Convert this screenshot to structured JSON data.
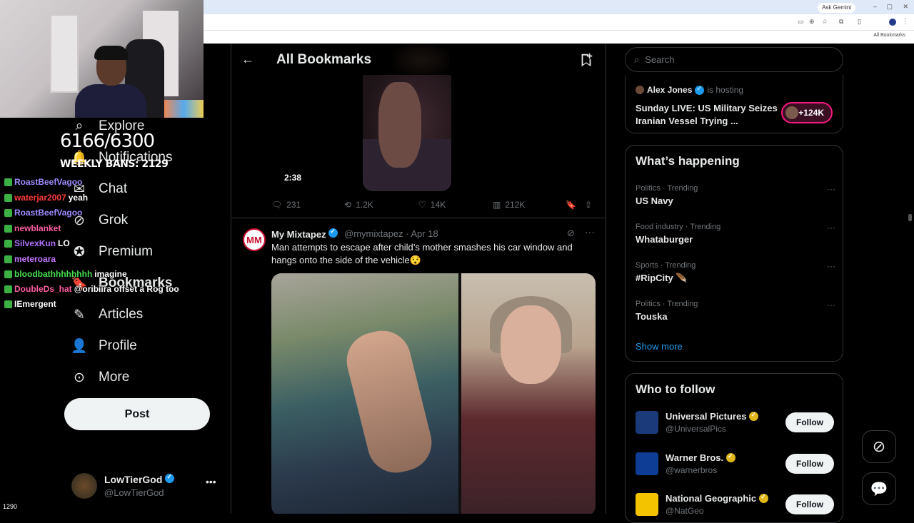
{
  "browser": {
    "ask_gemini": "Ask Gemini",
    "bookmarks_folder": "All Bookmarks",
    "window_controls": [
      "–",
      "▢",
      "✕"
    ]
  },
  "stream_overlay": {
    "counter": "6166/6300",
    "weekly_bans": "WEEKLY BANS: 2129",
    "viewer_count": "1290",
    "chat": [
      {
        "user": "RoastBeefVagoo",
        "color": "#9c8cff",
        "msg": ""
      },
      {
        "user": "waterjar2007",
        "color": "#ff3c3c",
        "msg": "yeah"
      },
      {
        "user": "RoastBeefVagoo",
        "color": "#9c8cff",
        "msg": ""
      },
      {
        "user": "newblanket",
        "color": "#ff5da2",
        "msg": ""
      },
      {
        "user": "SilvexKun",
        "color": "#b070ff",
        "msg": "LO"
      },
      {
        "user": "meteroara",
        "color": "#c678ff",
        "msg": ""
      },
      {
        "user": "bloodbathhhhhhhh",
        "color": "#47e04f",
        "msg": "imagine"
      },
      {
        "user": "DoubleDs_hat",
        "color": "#ff5da2",
        "msg": "@oribiira offset a Rog too"
      },
      {
        "user": "IEmergent",
        "color": "#ffffff",
        "msg": ""
      }
    ]
  },
  "nav": {
    "items": [
      {
        "label": "Explore",
        "icon": "search-icon"
      },
      {
        "label": "Notifications",
        "icon": "bell-icon"
      },
      {
        "label": "Chat",
        "icon": "chat-icon"
      },
      {
        "label": "Grok",
        "icon": "grok-icon"
      },
      {
        "label": "Premium",
        "icon": "premium-icon"
      },
      {
        "label": "Bookmarks",
        "icon": "bookmark-icon"
      },
      {
        "label": "Articles",
        "icon": "article-icon"
      },
      {
        "label": "Profile",
        "icon": "person-icon"
      },
      {
        "label": "More",
        "icon": "more-circle-icon"
      }
    ],
    "post_button": "Post",
    "account": {
      "name": "LowTierGod",
      "handle": "@LowTierGod"
    }
  },
  "main": {
    "header_title": "All Bookmarks",
    "tweet1": {
      "video_duration": "2:38",
      "replies": "231",
      "reposts": "1.2K",
      "likes": "14K",
      "views": "212K"
    },
    "tweet2": {
      "author_name": "My Mixtapez",
      "author_handle": "@mymixtapez · Apr 18",
      "avatar_text": "MM",
      "text": "Man attempts to escape after child’s mother smashes his car window and hangs onto the side of the vehicle😯"
    }
  },
  "right": {
    "search_placeholder": "Search",
    "space": {
      "host": "Alex Jones",
      "hosting": "is hosting",
      "title": "Sunday LIVE: US Military Seizes Iranian Vessel Trying ...",
      "listeners": "+124K"
    },
    "happening_title": "What’s happening",
    "trends": [
      {
        "category": "Politics · Trending",
        "name": "US Navy"
      },
      {
        "category": "Food industry · Trending",
        "name": "Whataburger"
      },
      {
        "category": "Sports · Trending",
        "name": "#RipCity 🪶"
      },
      {
        "category": "Politics · Trending",
        "name": "Touska"
      }
    ],
    "show_more": "Show more",
    "who_to_follow_title": "Who to follow",
    "follow": [
      {
        "name": "Universal Pictures",
        "handle": "@UniversalPics",
        "button": "Follow",
        "color": "#1a3a7a"
      },
      {
        "name": "Warner Bros.",
        "handle": "@warnerbros",
        "button": "Follow",
        "color": "#0d3d94"
      },
      {
        "name": "National Geographic",
        "handle": "@NatGeo",
        "button": "Follow",
        "color": "#f3c300"
      }
    ]
  }
}
